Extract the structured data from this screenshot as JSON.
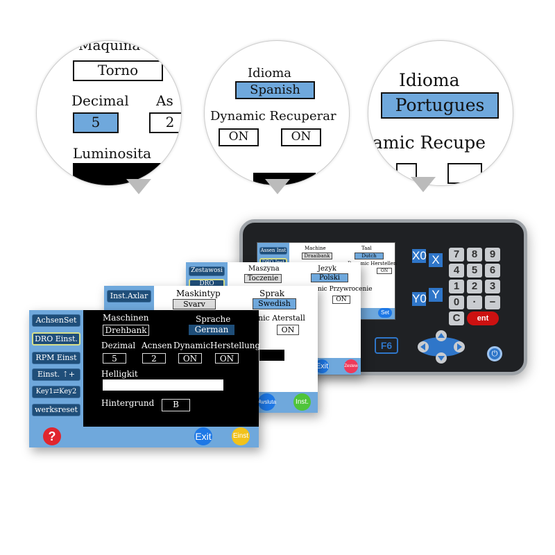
{
  "zoom_circles": [
    {
      "top_label": "Maquina",
      "machine_value": "Torno",
      "decimal_label": "Decimal",
      "axis_label": "As",
      "decimal_value": "5",
      "axis_value": "2",
      "brightness_label": "Luminosita"
    },
    {
      "language_label": "Idioma",
      "language_value": "Spanish",
      "dynamic_label": "Dynamic Recuperar",
      "dynamic_value": "ON",
      "restore_value": "ON"
    },
    {
      "language_label": "Idioma",
      "language_value": "Portugues",
      "dynamic_label": "amic Recupe"
    }
  ],
  "device": {
    "screen": {
      "sidebar": [
        "Assen Inst",
        "DRO Inst"
      ],
      "machine_label": "Machine",
      "machine_value": "Draaibank",
      "language_label": "Taal",
      "language_value": "Dutch",
      "row_label": "Dynamic Herstellen",
      "row_value": "ON",
      "set_button": "Set"
    },
    "axis_keys": [
      "X0",
      "X",
      "Y0",
      "Y"
    ],
    "keypad": [
      "7",
      "8",
      "9",
      "4",
      "5",
      "6",
      "1",
      "2",
      "3",
      "0",
      "·",
      "−",
      "C"
    ],
    "enter_key": "ent",
    "f6_key": "F6",
    "colors": {
      "axis_key": "#2f76c9",
      "enter_key": "#cc1111",
      "nav_pad": "#2f76c9"
    }
  },
  "screen_polish": {
    "sidebar": [
      "Zestawosi",
      "DRO"
    ],
    "machine_label": "Maszyna",
    "machine_value": "Toczenie",
    "language_label": "Jezyk",
    "language_value": "Polski",
    "restore_label": "nic Przywrocenie",
    "restore_value": "ON",
    "exit_button": "Exit",
    "set_button": "Zestew"
  },
  "screen_swedish": {
    "sidebar": [
      "Inst.Axlar"
    ],
    "machine_label": "Maskintyp",
    "machine_value": "Svarv",
    "language_label": "Sprak",
    "language_value": "Swedish",
    "restore_label": "nic Aterstall",
    "restore_value": "ON",
    "exit_button": "Avsluta",
    "set_button": "Inst."
  },
  "screen_german": {
    "sidebar": [
      "AchsenSet",
      "DRO Einst.",
      "RPM  Einst",
      "Einst.  ⇡+",
      "Key1⇄Key2",
      "werksreset"
    ],
    "active_item": "DRO Einst.",
    "machine_label": "Maschinen",
    "machine_value": "Drehbank",
    "language_label": "Sprache",
    "language_value": "German",
    "decimal_label": "Dezimal",
    "decimal_value": "5",
    "axes_label": "Acnsen",
    "axes_value": "2",
    "dynamic_label": "Dynamic",
    "dynamic_value": "ON",
    "restore_label": "Herstellung",
    "restore_value": "ON",
    "brightness_label": "Helligkit",
    "background_label": "Hintergrund",
    "background_value": "B",
    "help_button": "?",
    "exit_button": "Exit",
    "set_button": "Einst",
    "colors": {
      "sidebar": "#6fa8dc",
      "sidebar_button": "#1f4e79",
      "selected_field": "#1f4e79",
      "help": "#e0262e",
      "exit": "#1e78e6",
      "set": "#f2c21b"
    }
  }
}
